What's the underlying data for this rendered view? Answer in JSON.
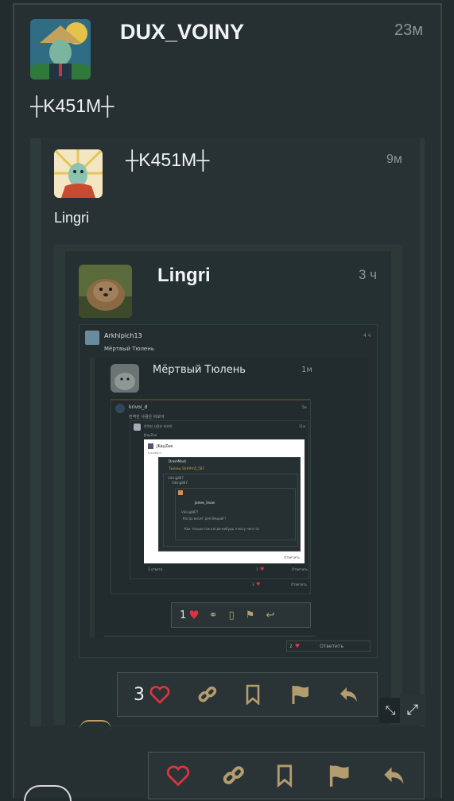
{
  "colors": {
    "background": "#222c2d",
    "frame": "#263033",
    "border": "#3a4546",
    "gold": "#b39c6e",
    "heart": "#e0333f"
  },
  "post": {
    "author": "DUX_VOINY",
    "time": "23м",
    "text": "┼K451M┼",
    "reply": {
      "author": "┼K451M┼",
      "time": "9м",
      "text": "Lingri",
      "reply": {
        "author": "Lingri",
        "time": "3 ч",
        "embed": {
          "author": "Arkhipich13",
          "time": "4 ч",
          "text": "Мёртвый Тюлень",
          "inner": {
            "author": "Мёртвый Тюлень",
            "time": "1м",
            "nested": {
              "author": "krivoi_d",
              "time": "5м",
              "text": "번역한 사람은 바보야",
              "quote": {
                "text": "번역한 사람은 바보야",
                "user": "JKayZee",
                "time": "11м",
                "white_card": {
                  "author": "JKayZee",
                  "sub": "DrashMack",
                  "lines": [
                    "DrashMack",
                    "Тюлень Sh##m5_587",
                    "Viking887",
                    "Viking887",
                    "James_Snow",
                    "Viking887!",
                    "Когда висит для Вящий?!",
                    "Как только так когда-нибудь я могу чего-то"
                  ],
                  "footer_reply": "Ответить"
                },
                "footer_count": "1",
                "footer_reply": "Ответить",
                "footer_left": "2 ответа"
              },
              "footer_count": "3",
              "footer_reply": "Ответить"
            },
            "actions_count": "1"
          },
          "footer_count": "2",
          "footer_reply": "Ответить"
        },
        "actions_count": "3"
      }
    }
  }
}
